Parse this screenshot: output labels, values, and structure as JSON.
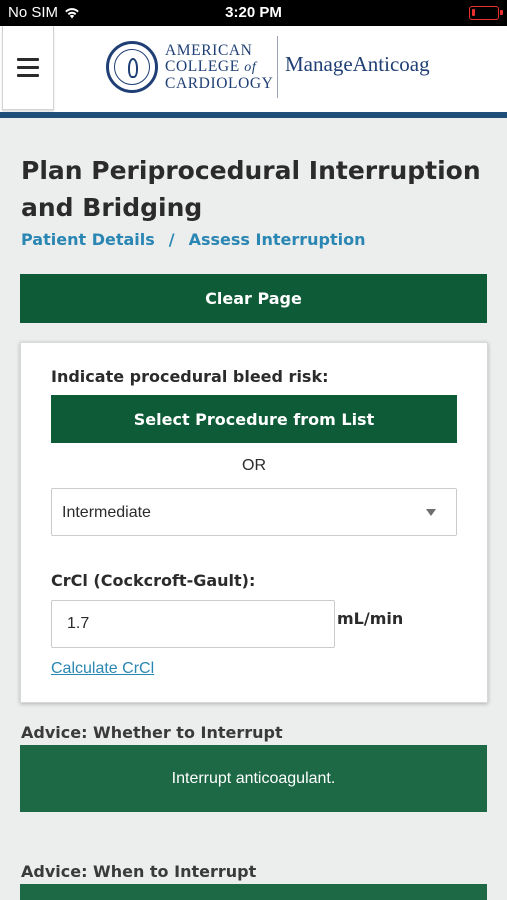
{
  "status_bar": {
    "carrier": "No SIM",
    "time": "3:20 PM",
    "battery_level": 0.1,
    "icons": [
      "wifi-icon",
      "battery-icon"
    ]
  },
  "header": {
    "logo_line1": "AMERICAN",
    "logo_line2_a": "COLLEGE",
    "logo_line2_b": "of",
    "logo_line3": "CARDIOLOGY",
    "brand": "ManageAnticoag",
    "menu_icon": "hamburger-menu-icon"
  },
  "page": {
    "title": "Plan Periprocedural Interruption and Bridging",
    "breadcrumb": {
      "item1": "Patient Details",
      "separator": "/",
      "item2": "Assess Interruption"
    },
    "clear_button": "Clear Page"
  },
  "form": {
    "bleed_risk_label": "Indicate procedural bleed risk:",
    "select_procedure_button": "Select Procedure from List",
    "or_text": "OR",
    "bleed_risk_value": "Intermediate",
    "crcl_label": "CrCl (Cockcroft-Gault):",
    "crcl_value": "1.7",
    "crcl_unit": "mL/min",
    "calculate_link": "Calculate CrCl"
  },
  "advice": {
    "whether_label": "Advice: Whether to Interrupt",
    "whether_text": "Interrupt anticoagulant.",
    "when_label": "Advice: When to Interrupt"
  },
  "colors": {
    "primary_green": "#0e5c37",
    "advice_green": "#1d6845",
    "link_blue": "#2a86b3",
    "brand_navy": "#1f3f75",
    "battery_red": "#e8312f"
  }
}
